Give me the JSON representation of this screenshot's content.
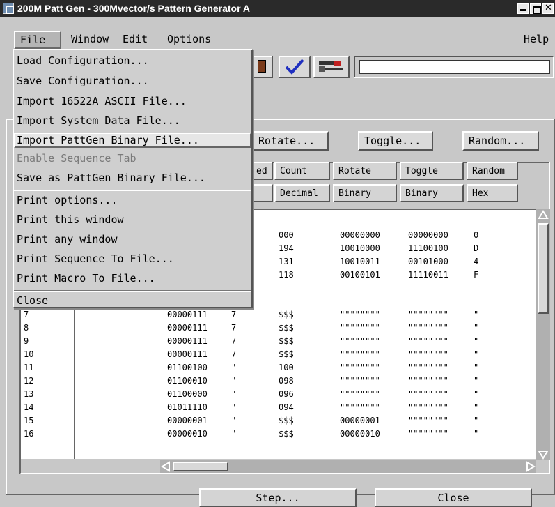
{
  "window": {
    "title": "200M Patt Gen - 300Mvector/s Pattern Generator A"
  },
  "menubar": {
    "file": "File",
    "window": "Window",
    "edit": "Edit",
    "options": "Options",
    "help": "Help"
  },
  "file_menu": {
    "items": [
      "Load Configuration...",
      "Save Configuration...",
      "Import 16522A ASCII File...",
      "Import System Data File...",
      "Import PattGen Binary File...",
      "Enable Sequence Tab",
      "Save as PattGen Binary File...",
      "Print options...",
      "Print this window",
      "Print any window",
      "Print Sequence To File...",
      "Print Macro To File...",
      "Close"
    ],
    "highlighted_index": 4,
    "disabled_index": 5
  },
  "actions": {
    "rotate": "Rotate...",
    "toggle": "Toggle...",
    "random": "Random..."
  },
  "table": {
    "headers_top": [
      "ed",
      "Count",
      "Rotate",
      "Toggle",
      "Random"
    ],
    "headers_bottom": [
      "Decimal",
      "Binary",
      "Binary",
      "Hex"
    ],
    "upper_rows": [
      {
        "count": "000",
        "rotate": "00000000",
        "toggle": "00000000",
        "random": "0"
      },
      {
        "count": "194",
        "rotate": "10010000",
        "toggle": "11100100",
        "random": "D"
      },
      {
        "count": "131",
        "rotate": "10010011",
        "toggle": "00101000",
        "random": "4"
      },
      {
        "count": "118",
        "rotate": "00100101",
        "toggle": "11110011",
        "random": "F"
      }
    ],
    "rows": [
      {
        "n": "7",
        "bin": "00000111",
        "ed": "7",
        "count": "$$$",
        "rotate": "\"\"\"\"\"\"\"\"",
        "toggle": "\"\"\"\"\"\"\"\"",
        "random": "\""
      },
      {
        "n": "8",
        "bin": "00000111",
        "ed": "7",
        "count": "$$$",
        "rotate": "\"\"\"\"\"\"\"\"",
        "toggle": "\"\"\"\"\"\"\"\"",
        "random": "\""
      },
      {
        "n": "9",
        "bin": "00000111",
        "ed": "7",
        "count": "$$$",
        "rotate": "\"\"\"\"\"\"\"\"",
        "toggle": "\"\"\"\"\"\"\"\"",
        "random": "\""
      },
      {
        "n": "10",
        "bin": "00000111",
        "ed": "7",
        "count": "$$$",
        "rotate": "\"\"\"\"\"\"\"\"",
        "toggle": "\"\"\"\"\"\"\"\"",
        "random": "\""
      },
      {
        "n": "11",
        "bin": "01100100",
        "ed": "\"",
        "count": "100",
        "rotate": "\"\"\"\"\"\"\"\"",
        "toggle": "\"\"\"\"\"\"\"\"",
        "random": "\""
      },
      {
        "n": "12",
        "bin": "01100010",
        "ed": "\"",
        "count": "098",
        "rotate": "\"\"\"\"\"\"\"\"",
        "toggle": "\"\"\"\"\"\"\"\"",
        "random": "\""
      },
      {
        "n": "13",
        "bin": "01100000",
        "ed": "\"",
        "count": "096",
        "rotate": "\"\"\"\"\"\"\"\"",
        "toggle": "\"\"\"\"\"\"\"\"",
        "random": "\""
      },
      {
        "n": "14",
        "bin": "01011110",
        "ed": "\"",
        "count": "094",
        "rotate": "\"\"\"\"\"\"\"\"",
        "toggle": "\"\"\"\"\"\"\"\"",
        "random": "\""
      },
      {
        "n": "15",
        "bin": "00000001",
        "ed": "\"",
        "count": "$$$",
        "rotate": "00000001",
        "toggle": "\"\"\"\"\"\"\"\"",
        "random": "\""
      },
      {
        "n": "16",
        "bin": "00000010",
        "ed": "\"",
        "count": "$$$",
        "rotate": "00000010",
        "toggle": "\"\"\"\"\"\"\"\"",
        "random": "\""
      }
    ]
  },
  "bottom": {
    "step": "Step...",
    "close": "Close"
  }
}
